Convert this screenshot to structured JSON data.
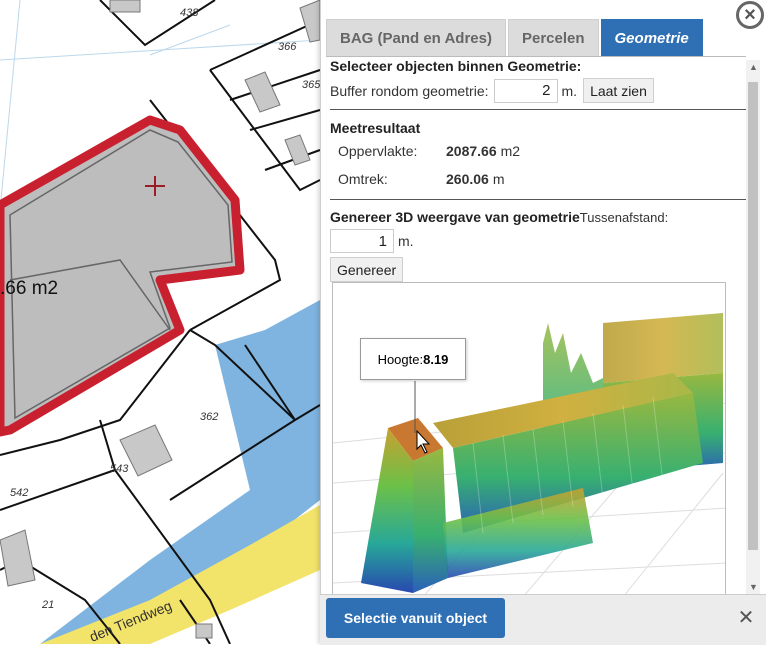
{
  "map": {
    "parcel_numbers": [
      "438",
      "366",
      "365",
      "362",
      "543",
      "542",
      "21"
    ],
    "area_label": ".66 m2",
    "street_name": "den Tiendweg"
  },
  "tabs": [
    {
      "label": "BAG (Pand en Adres)",
      "active": false
    },
    {
      "label": "Percelen",
      "active": false
    },
    {
      "label": "Geometrie",
      "active": true
    }
  ],
  "select_section": {
    "title": "Selecteer objecten binnen Geometrie:",
    "buffer_label": "Buffer rondom geometrie:",
    "buffer_value": "2",
    "buffer_unit": "m.",
    "show_button": "Laat zien"
  },
  "measurement": {
    "title": "Meetresultaat",
    "area_label": "Oppervlakte:",
    "area_value": "2087.66",
    "area_unit": "m2",
    "perimeter_label": "Omtrek:",
    "perimeter_value": "260.06",
    "perimeter_unit": "m"
  },
  "generate_section": {
    "title": "Genereer 3D weergave van geometrie",
    "spacing_label": "Tussenafstand:",
    "spacing_value": "1",
    "spacing_unit": "m.",
    "generate_button": "Genereer"
  },
  "tooltip": {
    "label": "Hoogte: ",
    "value": "8.19"
  },
  "footer": {
    "select_button": "Selectie vanuit object"
  },
  "icons": {
    "close_top": "close-icon",
    "close_footer": "close-icon",
    "map_center": "crosshair-icon"
  },
  "colors": {
    "accent": "#2f6fb4",
    "selection_outline": "#c8202e",
    "water": "#7fb4e0",
    "road": "#f2e36a"
  }
}
